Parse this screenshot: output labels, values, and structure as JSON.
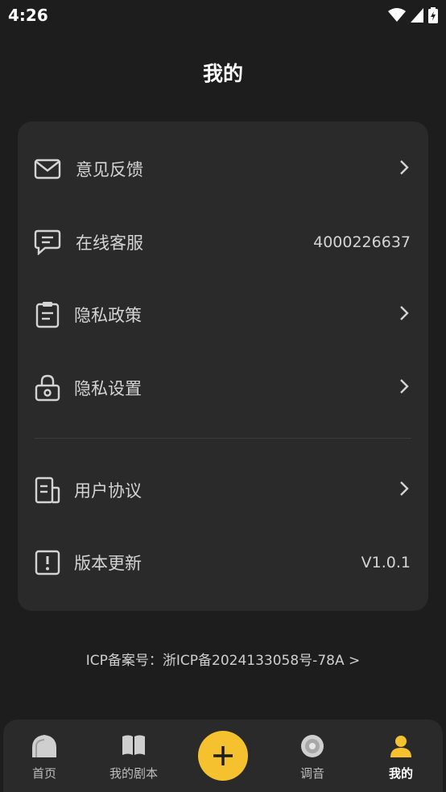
{
  "status_bar": {
    "time": "4:26"
  },
  "header": {
    "title": "我的"
  },
  "menu": {
    "feedback": {
      "label": "意见反馈"
    },
    "customer_service": {
      "label": "在线客服",
      "value": "4000226637"
    },
    "privacy_policy": {
      "label": "隐私政策"
    },
    "privacy_settings": {
      "label": "隐私设置"
    },
    "user_agreement": {
      "label": "用户协议"
    },
    "version": {
      "label": "版本更新",
      "value": "V1.0.1"
    }
  },
  "icp": {
    "text": "ICP备案号：浙ICP备2024133058号-78A >"
  },
  "tabbar": {
    "home": "首页",
    "my_scripts": "我的剧本",
    "tuning": "调音",
    "mine": "我的"
  },
  "colors": {
    "accent": "#f5c12e",
    "background": "#1d1d1d",
    "card": "#2a2a2a"
  }
}
